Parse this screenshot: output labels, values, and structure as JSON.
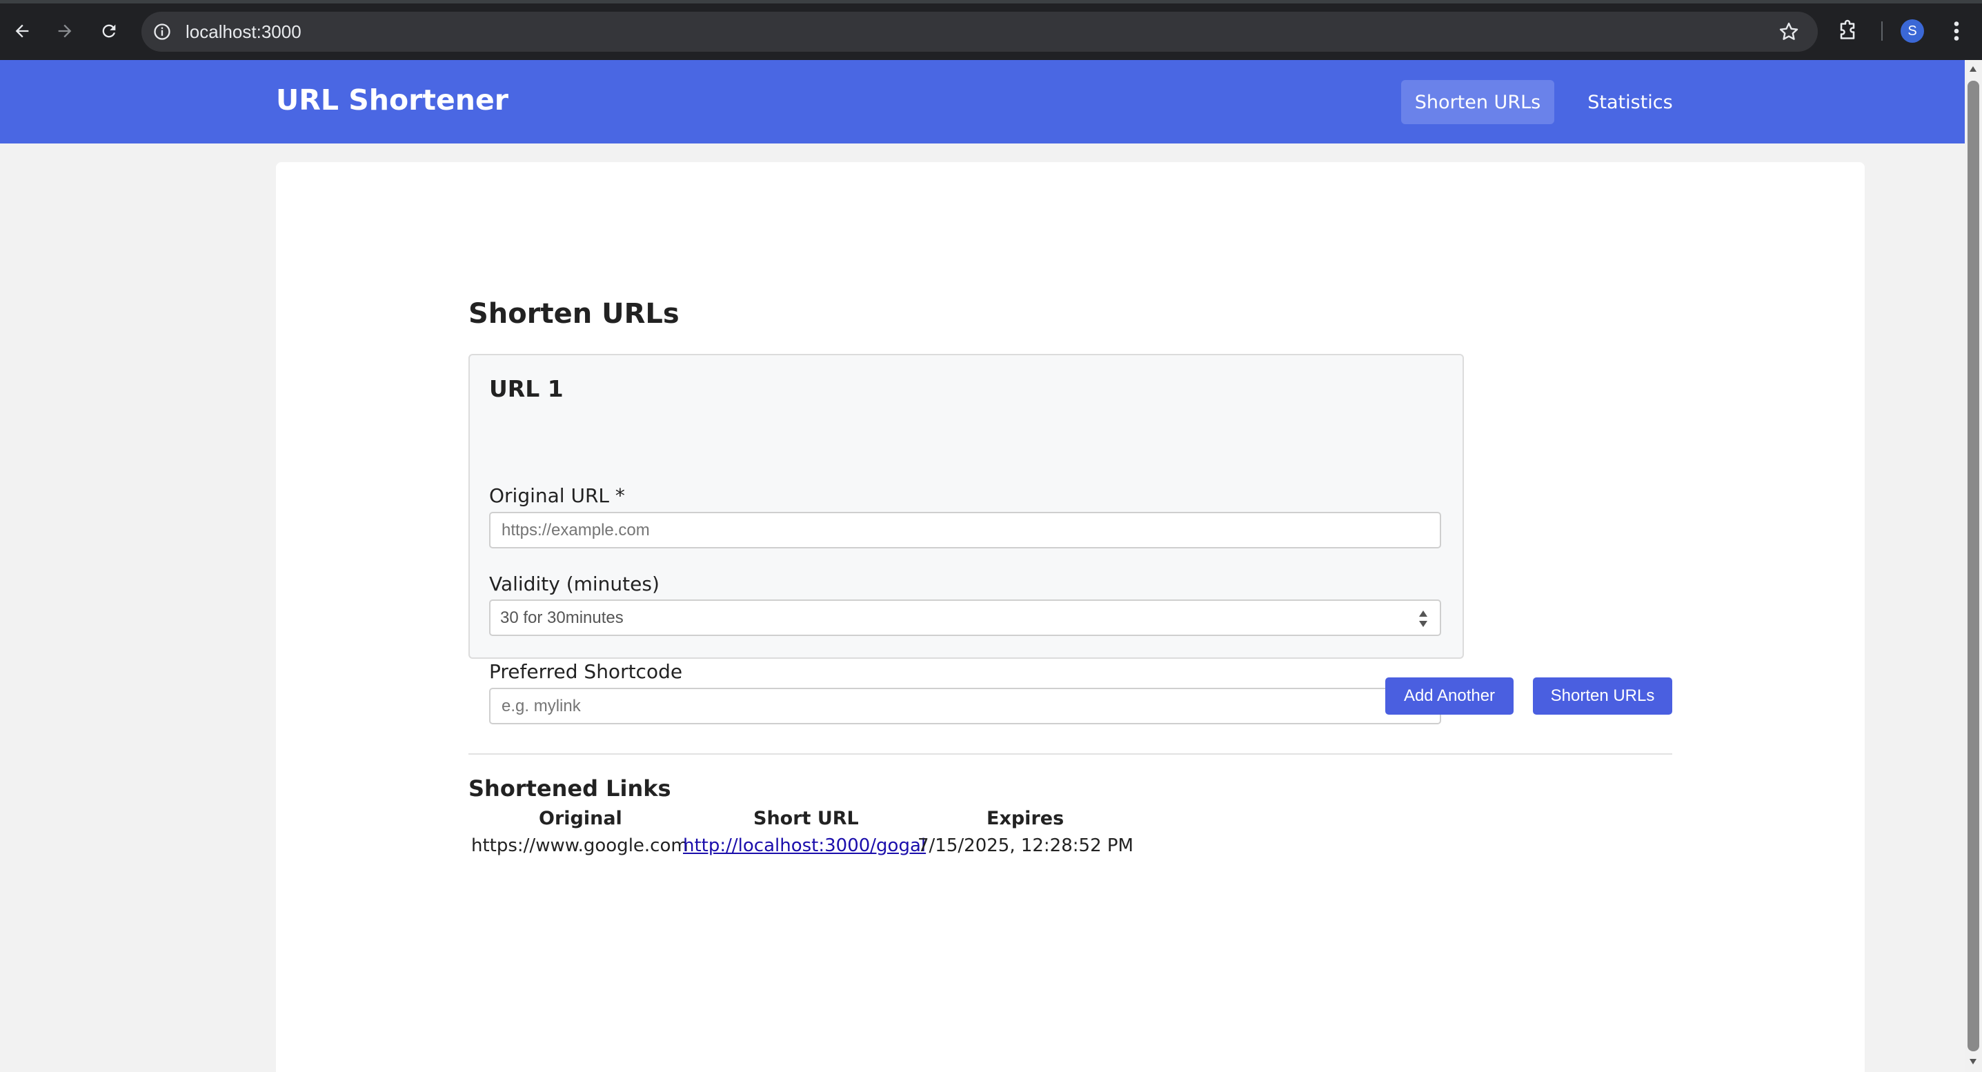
{
  "browser": {
    "url": "localhost:3000",
    "profile_initial": "S",
    "icons": [
      "back-icon",
      "forward-icon",
      "reload-icon",
      "info-icon",
      "star-icon",
      "extensions-icon",
      "more-icon"
    ]
  },
  "header": {
    "brand": "URL Shortener",
    "nav": [
      {
        "label": "Shorten URLs",
        "active": true
      },
      {
        "label": "Statistics",
        "active": false
      }
    ],
    "color": "#4a67e3"
  },
  "form": {
    "title": "Shorten URLs",
    "entry_title": "URL 1",
    "original_label": "Original URL *",
    "original_placeholder": "https://example.com",
    "validity_label": "Validity (minutes)",
    "validity_value": "30 for 30minutes",
    "shortcode_label": "Preferred Shortcode",
    "shortcode_placeholder": "e.g. mylink",
    "add_button": "Add Another",
    "submit_button": "Shorten URLs",
    "button_color": "#4a5fe0"
  },
  "results": {
    "title": "Shortened Links",
    "columns": [
      "Original",
      "Short URL",
      "Expires"
    ],
    "rows": [
      {
        "original": "https://www.google.com",
        "short": "http://localhost:3000/gogal",
        "expires": "7/15/2025, 12:28:52 PM"
      }
    ]
  }
}
